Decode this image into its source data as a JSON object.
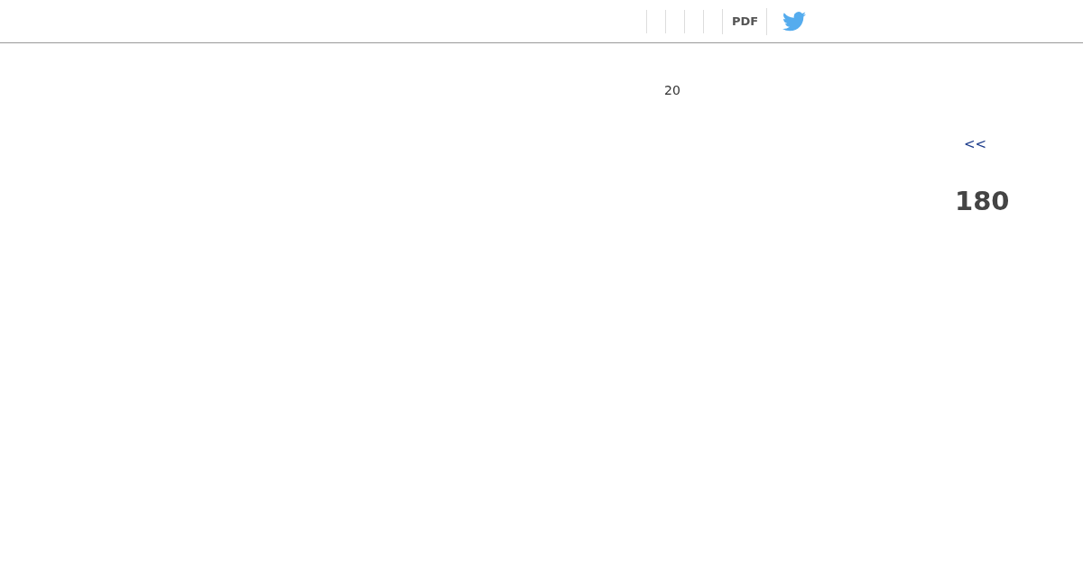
{
  "toolbar": {
    "pdf_link": "PDF"
  },
  "main": {
    "count": "20",
    "back_link": "<<",
    "total": "180"
  }
}
